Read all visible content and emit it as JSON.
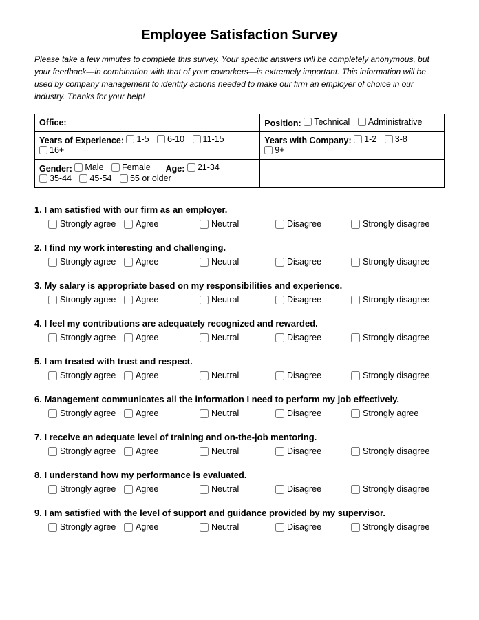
{
  "title": "Employee Satisfaction Survey",
  "intro": "Please take a few minutes to complete this survey. Your specific answers will be completely anonymous, but your feedback—in combination with that of your coworkers—is extremely important. This information will be used by company management to identify actions needed to make our firm an employer of choice in our industry. Thanks for your help!",
  "demographics": {
    "office_label": "Office:",
    "position_label": "Position:",
    "position_options": [
      "Technical",
      "Administrative"
    ],
    "years_exp_label": "Years of Experience:",
    "years_exp_options": [
      "1-5",
      "6-10",
      "11-15",
      "16+"
    ],
    "years_company_label": "Years with Company:",
    "years_company_options": [
      "1-2",
      "3-8",
      "9+"
    ],
    "gender_label": "Gender:",
    "gender_options": [
      "Male",
      "Female"
    ],
    "age_label": "Age:",
    "age_options": [
      "21-34",
      "35-44",
      "45-54",
      "55 or older"
    ]
  },
  "scale": [
    "Strongly agree",
    "Agree",
    "Neutral",
    "Disagree",
    "Strongly disagree"
  ],
  "scale_q6": [
    "Strongly agree",
    "Agree",
    "Neutral",
    "Disagree",
    "Strongly agree"
  ],
  "questions": [
    {
      "num": "1",
      "text": "I am satisfied with our firm as an employer."
    },
    {
      "num": "2",
      "text": "I find my work interesting and challenging."
    },
    {
      "num": "3",
      "text": "My salary is appropriate based on my responsibilities and experience."
    },
    {
      "num": "4",
      "text": "I feel my contributions are adequately recognized and rewarded."
    },
    {
      "num": "5",
      "text": "I am treated with trust and respect."
    },
    {
      "num": "6",
      "text": "Management communicates all the information I need to perform my job effectively."
    },
    {
      "num": "7",
      "text": "I receive an adequate level of training and on-the-job mentoring."
    },
    {
      "num": "8",
      "text": "I understand how my performance is evaluated."
    },
    {
      "num": "9",
      "text": "I am satisfied with the level of support and guidance provided by my supervisor."
    }
  ]
}
